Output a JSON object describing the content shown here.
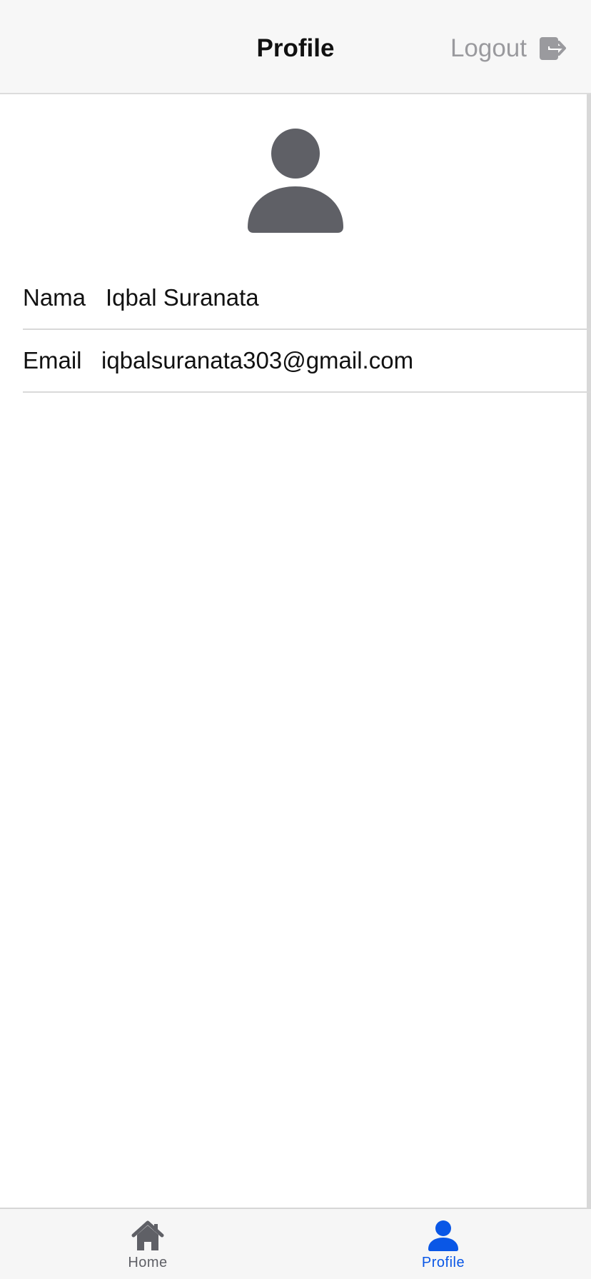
{
  "header": {
    "title": "Profile",
    "logout_label": "Logout",
    "logout_icon": "logout-icon"
  },
  "avatar": {
    "icon": "person-icon",
    "color": "#5f6066"
  },
  "profile": {
    "rows": [
      {
        "label": "Nama",
        "value": "Iqbal Suranata"
      },
      {
        "label": "Email",
        "value": "iqbalsuranata303@gmail.com"
      }
    ]
  },
  "tab_bar": {
    "tabs": [
      {
        "label": "Home",
        "icon": "home-icon",
        "color": "#5f6066",
        "active": false
      },
      {
        "label": "Profile",
        "icon": "person-icon",
        "color": "#0a57e6",
        "active": true
      }
    ]
  },
  "colors": {
    "header_bg": "#f7f7f7",
    "muted_text": "#9a9a9e",
    "accent": "#0a57e6"
  }
}
